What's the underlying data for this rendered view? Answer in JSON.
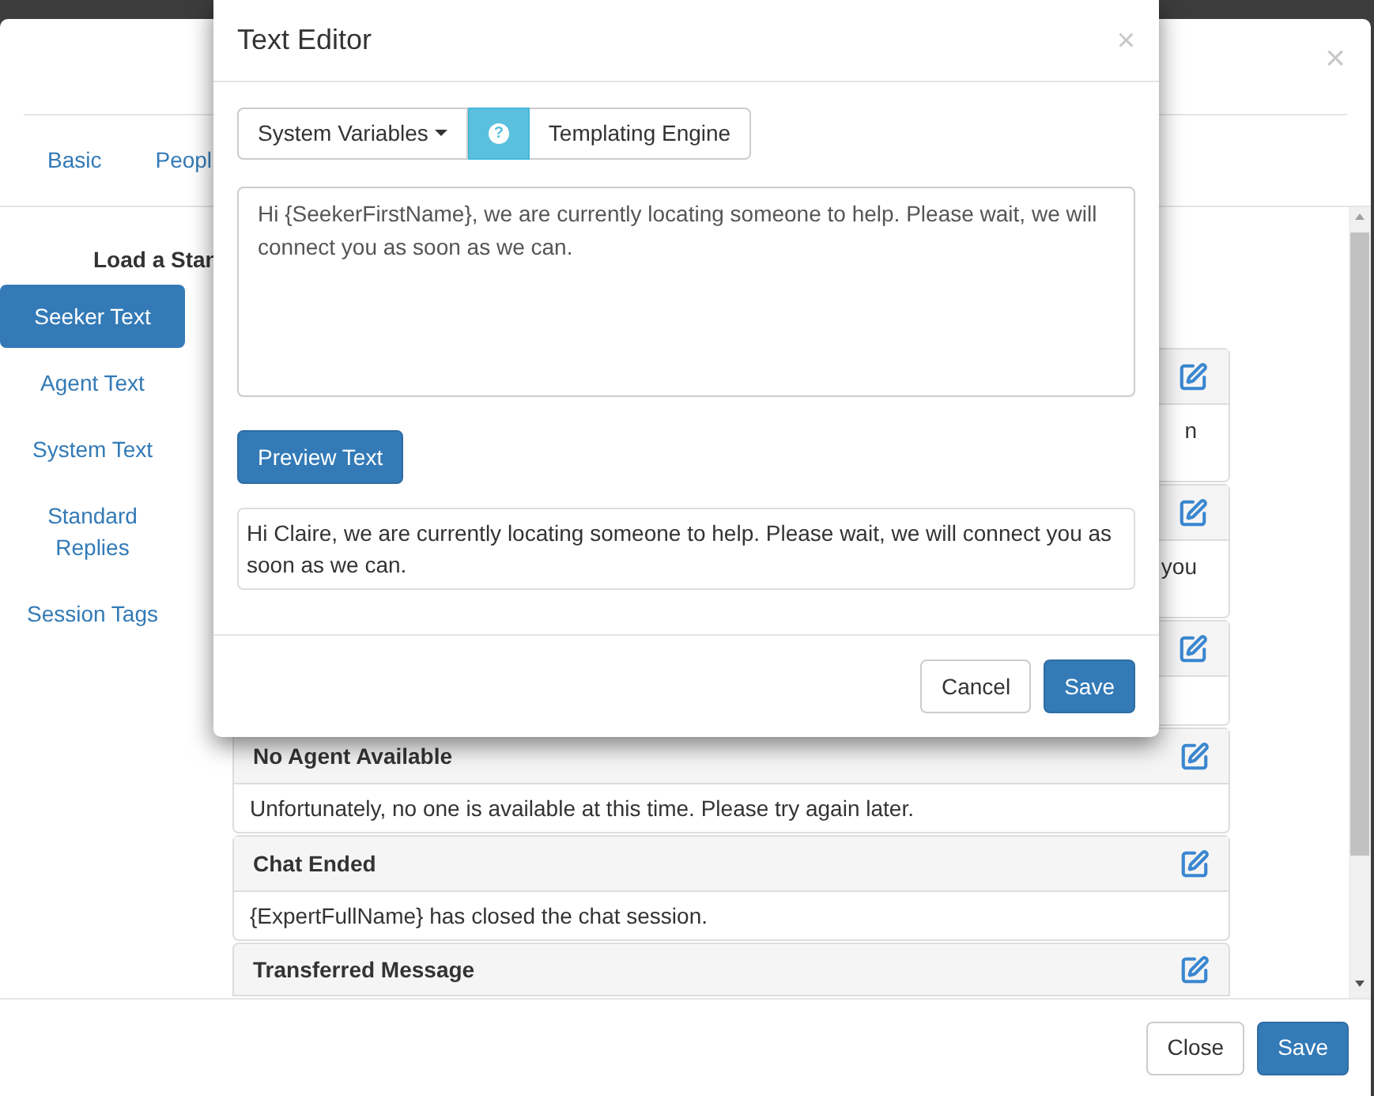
{
  "background_window": {
    "close": "×",
    "tabs": [
      {
        "label": "Basic"
      },
      {
        "label": "Peopl"
      }
    ],
    "sidebar": {
      "heading": "Load a Stan",
      "items": [
        {
          "label": "Seeker Text",
          "selected": true
        },
        {
          "label": "Agent Text",
          "selected": false
        },
        {
          "label": "System Text",
          "selected": false
        },
        {
          "label": "Standard Replies",
          "selected": false
        },
        {
          "label": "Session Tags",
          "selected": false
        }
      ]
    },
    "panels": [
      {
        "kind": "covered",
        "fragment": "n"
      },
      {
        "kind": "covered",
        "fragment": "you"
      },
      {
        "kind": "covered"
      },
      {
        "kind": "full",
        "title": "No Agent Available",
        "body": "Unfortunately, no one is available at this time. Please try again later."
      },
      {
        "kind": "full",
        "title": "Chat Ended",
        "body": "{ExpertFullName} has closed the chat session."
      },
      {
        "kind": "clipped",
        "title": "Transferred Message"
      }
    ],
    "footer_buttons": [
      {
        "label": "Close",
        "kind": "default"
      },
      {
        "label": "Save",
        "kind": "primary"
      }
    ]
  },
  "text_editor": {
    "title": "Text Editor",
    "close": "×",
    "toolbar": {
      "dropdown": "System Variables",
      "help_symbol": "?",
      "link": "Templating Engine"
    },
    "template_value": "Hi {SeekerFirstName}, we are currently locating someone to help. Please wait, we will connect you as soon as we can.",
    "preview_button": "Preview Text",
    "preview": "Hi Claire, we are currently locating someone to help. Please wait, we will connect you as soon as we can.",
    "footer_buttons": [
      {
        "label": "Cancel",
        "kind": "default"
      },
      {
        "label": "Save",
        "kind": "primary"
      }
    ]
  }
}
